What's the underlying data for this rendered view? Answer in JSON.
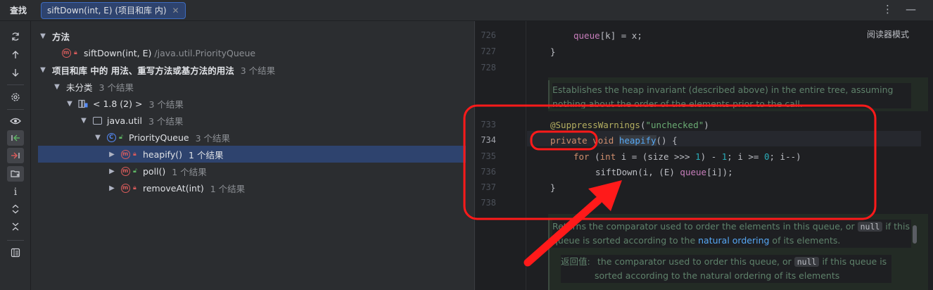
{
  "header": {
    "find_title": "查找",
    "tab_label": "siftDown(int, E) (项目和库 内)",
    "tab_close": "✕",
    "more_icon": "⋮",
    "minimize_icon": "—"
  },
  "tree": {
    "methods_header": "方法",
    "target_method": "siftDown(int, E)",
    "target_path": "/java.util.PriorityQueue",
    "usages_header": "项目和库 中的 用法、重写方法或基方法的用法",
    "usages_count": "3 个结果",
    "uncategorized": "未分类",
    "uncategorized_count": "3 个结果",
    "jdk": "< 1.8 (2) >",
    "jdk_count": "3 个结果",
    "package": "java.util",
    "package_count": "3 个结果",
    "class": "PriorityQueue",
    "class_count": "3 个结果",
    "items": [
      {
        "label": "heapify()",
        "count": "1 个结果"
      },
      {
        "label": "poll()",
        "count": "1 个结果"
      },
      {
        "label": "removeAt(int)",
        "count": "1 个结果"
      }
    ]
  },
  "editor": {
    "reader_mode": "阅读器模式",
    "lines": [
      "726",
      "727",
      "728",
      "733",
      "734",
      "735",
      "736",
      "737",
      "738"
    ],
    "doc1": "Establishes the heap invariant (described above) in the entire tree, assuming nothing about the order of the elements prior to the call.",
    "doc2_a": "Returns the comparator used to order the elements in this queue, or",
    "doc2_null": "null",
    "doc2_b": "if this queue is sorted according to the",
    "doc2_link": "natural ordering",
    "doc2_c": "of its elements.",
    "doc3_label": "返回值:",
    "doc3_a": "the comparator used to order this queue, or",
    "doc3_null": "null",
    "doc3_b": "if this queue is",
    "doc3_c": "sorted according to the natural ordering of its elements"
  },
  "colors": {
    "annotation_red": "#ff1a1a",
    "selection": "#2e436e",
    "accent": "#548af7"
  }
}
